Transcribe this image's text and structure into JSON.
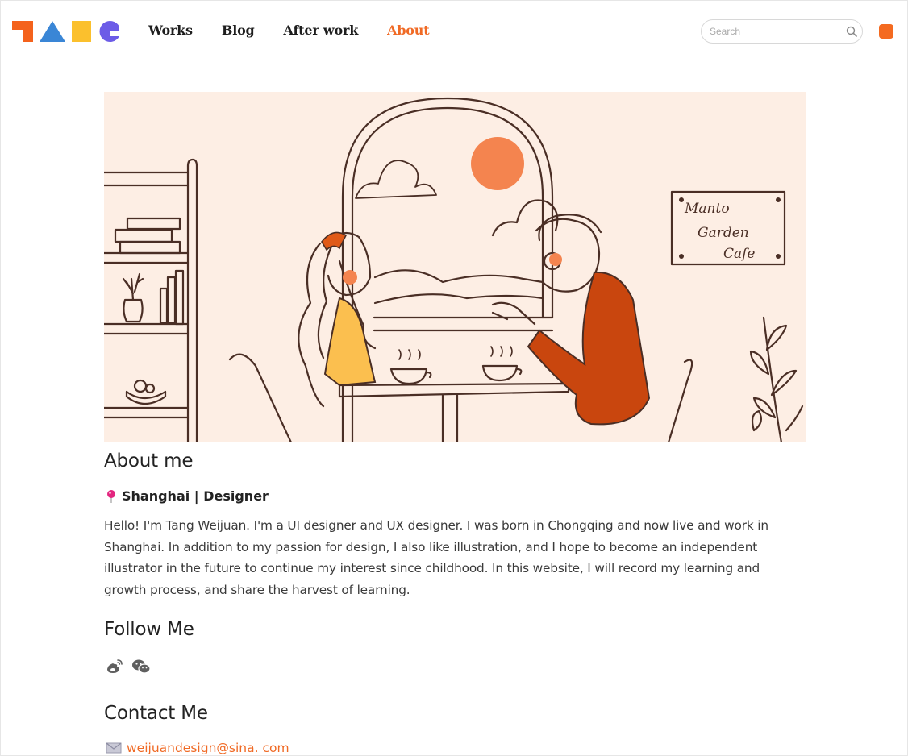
{
  "nav": {
    "items": [
      {
        "label": "Works",
        "active": false
      },
      {
        "label": "Blog",
        "active": false
      },
      {
        "label": "After work",
        "active": false
      },
      {
        "label": "About",
        "active": true
      }
    ],
    "active_color": "#f06a25"
  },
  "search": {
    "placeholder": "Search",
    "value": ""
  },
  "brand": {
    "accent": "#f46a20"
  },
  "hero": {
    "sign_lines": [
      "Manto",
      "Garden",
      "Cafe"
    ]
  },
  "about": {
    "title": "About me",
    "location": "Shanghai | Designer",
    "bio": "Hello! I'm Tang Weijuan. I'm a UI designer and UX designer. I was born in Chongqing and now live and work in Shanghai. In addition to my passion for design, I also like illustration, and I hope to become an independent illustrator in the future to continue my interest since childhood. In this website, I will record my learning and growth process, and share the harvest of learning."
  },
  "follow": {
    "title": "Follow Me",
    "icons": [
      "weibo-icon",
      "wechat-icon"
    ]
  },
  "contact": {
    "title": "Contact Me",
    "email": "weijuandesign@sina. com"
  }
}
